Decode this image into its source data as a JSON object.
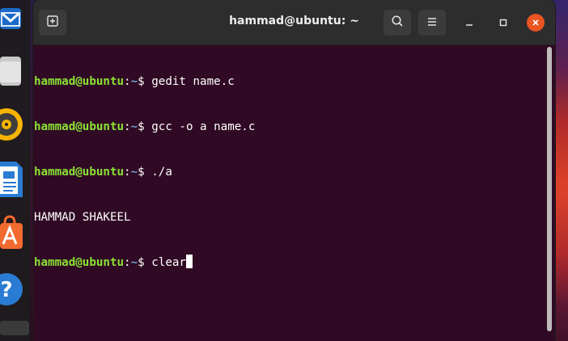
{
  "window": {
    "title": "hammad@ubuntu: ~"
  },
  "titlebar": {
    "new_tab_icon": "new-tab-icon",
    "search_icon": "search-icon",
    "menu_icon": "hamburger-menu-icon",
    "minimize_icon": "minimize-icon",
    "maximize_icon": "maximize-icon",
    "close_icon": "close-icon"
  },
  "terminal": {
    "prompt_user": "hammad@ubuntu",
    "prompt_colon": ":",
    "prompt_path": "~",
    "prompt_symbol": "$ ",
    "lines": [
      {
        "type": "prompt",
        "command": "gedit name.c"
      },
      {
        "type": "prompt",
        "command": "gcc -o a name.c"
      },
      {
        "type": "prompt",
        "command": "./a"
      },
      {
        "type": "output",
        "text": "HAMMAD SHAKEEL"
      },
      {
        "type": "prompt",
        "command": "clear"
      }
    ]
  },
  "dock": {
    "items": [
      "thunderbird-icon",
      "files-icon",
      "rhythmbox-icon",
      "libreoffice-writer-icon",
      "software-center-icon",
      "help-icon"
    ]
  },
  "colors": {
    "terminal_bg": "#300a24",
    "prompt_user": "#8ae234",
    "prompt_path": "#729fcf",
    "close_button": "#e95420"
  }
}
